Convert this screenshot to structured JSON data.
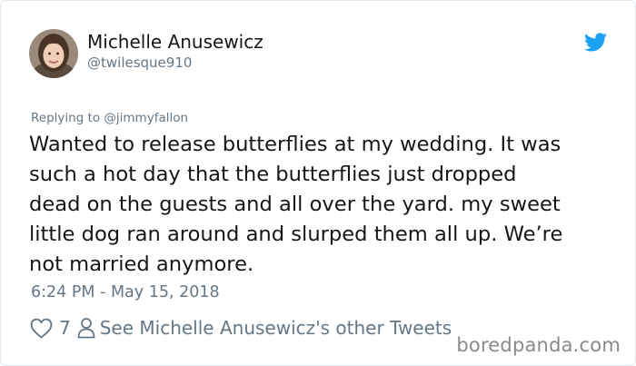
{
  "tweet": {
    "author": {
      "display_name": "Michelle Anusewicz",
      "handle": "@twilesque910",
      "avatar_icon": "avatar"
    },
    "brand_icon": "twitter-bird-icon",
    "replying_to": {
      "prefix": "Replying to",
      "mention": "@jimmyfallon"
    },
    "text_lines": [
      "Wanted to release butterflies at my wedding. It was",
      "such a hot day that the butterflies just dropped",
      "dead on the guests and all over the yard. my sweet",
      "little dog ran around and slurped them all up. We’re",
      "not married anymore."
    ],
    "timestamp": "6:24 PM - May 15, 2018",
    "like_count": "7",
    "other_tweets_link": "See Michelle Anusewicz's other Tweets"
  },
  "watermark": "boredpanda.com",
  "colors": {
    "text": "#14171a",
    "secondary": "#657786",
    "twitter_blue": "#1da1f2",
    "border": "#e1e8ed"
  }
}
